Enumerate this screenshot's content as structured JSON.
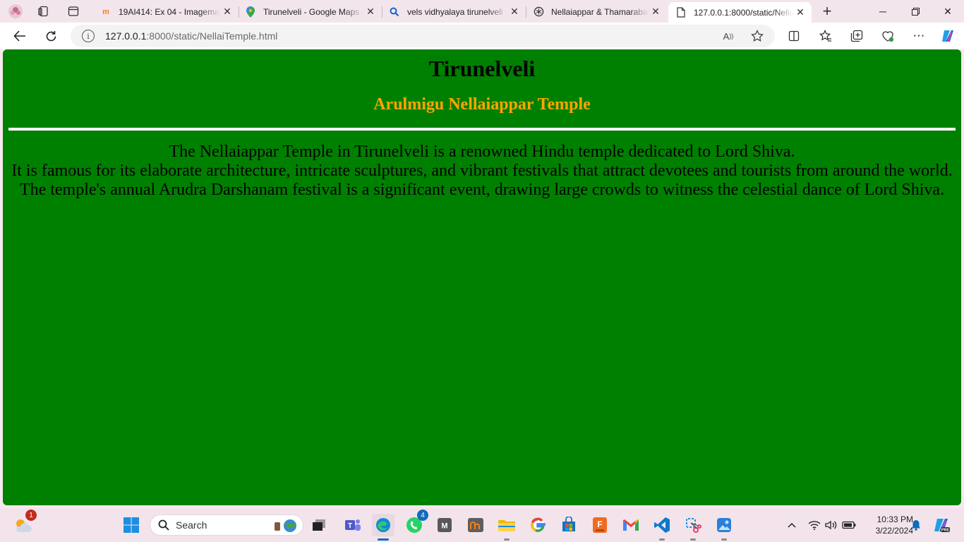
{
  "tabs": [
    {
      "title": "19AI414: Ex 04 - Imagemap",
      "icon": "moodle-icon"
    },
    {
      "title": "Tirunelveli - Google Maps",
      "icon": "maps-pin-icon"
    },
    {
      "title": "vels vidhyalaya tirunelveli",
      "icon": "search-icon"
    },
    {
      "title": "Nellaiappar & Thamarabarani",
      "icon": "chatgpt-icon"
    },
    {
      "title": "127.0.0.1:8000/static/NellaiTemple.html",
      "icon": "page-icon",
      "active": true
    }
  ],
  "address": {
    "host": "127.0.0.1",
    "rest": ":8000/static/NellaiTemple.html"
  },
  "page": {
    "heading": "Tirunelveli",
    "subheading": "Arulmigu Nellaiappar Temple",
    "paragraph_lines": [
      "The Nellaiappar Temple in Tirunelveli is a renowned Hindu temple dedicated to Lord Shiva.",
      "It is famous for its elaborate architecture, intricate sculptures, and vibrant festivals that attract devotees and tourists from around the world.",
      "The temple's annual Arudra Darshanam festival is a significant event, drawing large crowds to witness the celestial dance of Lord Shiva."
    ],
    "background_color": "#008000",
    "subheading_color": "#ffa500"
  },
  "taskbar": {
    "search_label": "Search",
    "whatsapp_badge": "4",
    "weather_badge": "1",
    "time": "10:33 PM",
    "date": "3/22/2024"
  }
}
